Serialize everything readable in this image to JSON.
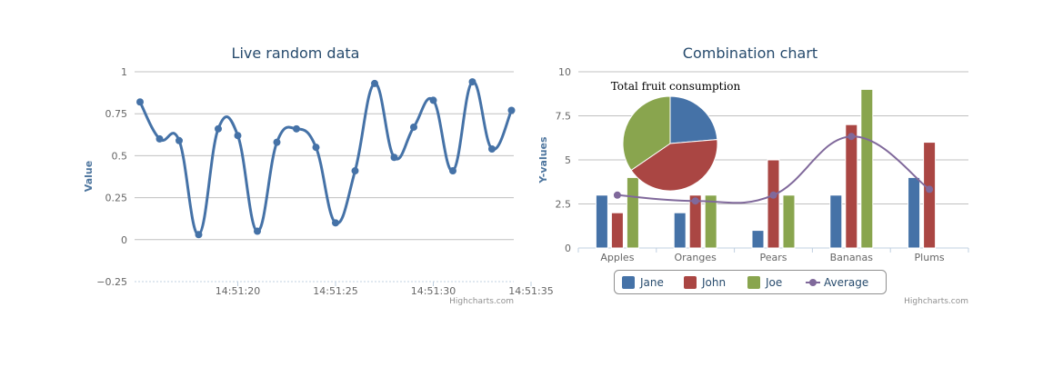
{
  "chart_data": [
    {
      "type": "line",
      "title": "Live random data",
      "xlabel": "",
      "ylabel": "Value",
      "ylim": [
        -0.25,
        1
      ],
      "yticks": [
        "1",
        "0.75",
        "0.5",
        "0.25",
        "0",
        "−0.25"
      ],
      "xticks": [
        "14:51:20",
        "14:51:25",
        "14:51:30",
        "14:51:35"
      ],
      "x": [
        "14:51:15",
        "14:51:16",
        "14:51:17",
        "14:51:18",
        "14:51:19",
        "14:51:20",
        "14:51:21",
        "14:51:22",
        "14:51:23",
        "14:51:24",
        "14:51:25",
        "14:51:26",
        "14:51:27",
        "14:51:28",
        "14:51:29",
        "14:51:30",
        "14:51:31",
        "14:51:32",
        "14:51:33",
        "14:51:34"
      ],
      "series": [
        {
          "values": [
            0.82,
            0.6,
            0.59,
            0.03,
            0.66,
            0.62,
            0.05,
            0.58,
            0.66,
            0.55,
            0.1,
            0.41,
            0.93,
            0.49,
            0.67,
            0.83,
            0.41,
            0.94,
            0.54,
            0.77
          ],
          "color": "#4572a7"
        }
      ],
      "grid": true,
      "credits": "Highcharts.com"
    },
    {
      "type": "bar",
      "title": "Combination chart",
      "xlabel": "",
      "ylabel": "Y-values",
      "ylim": [
        0,
        10
      ],
      "yticks": [
        "0",
        "2.5",
        "5",
        "7.5",
        "10"
      ],
      "categories": [
        "Apples",
        "Oranges",
        "Pears",
        "Bananas",
        "Plums"
      ],
      "series": [
        {
          "name": "Jane",
          "values": [
            3,
            2,
            1,
            3,
            4
          ],
          "color": "#4572a7"
        },
        {
          "name": "John",
          "values": [
            2,
            3,
            5,
            7,
            6
          ],
          "color": "#aa4643"
        },
        {
          "name": "Joe",
          "values": [
            4,
            3,
            3,
            9,
            0
          ],
          "color": "#89a54e"
        },
        {
          "name": "Average",
          "type": "spline",
          "values": [
            3,
            2.67,
            3,
            6.33,
            3.33
          ],
          "color": "#80699b"
        }
      ],
      "pie": {
        "title": "Total fruit consumption",
        "slices": [
          {
            "name": "Jane",
            "value": 13,
            "color": "#4572a7"
          },
          {
            "name": "John",
            "value": 23,
            "color": "#aa4643"
          },
          {
            "name": "Joe",
            "value": 19,
            "color": "#89a54e"
          }
        ]
      },
      "legend": "bottom-center",
      "grid": true,
      "credits": "Highcharts.com"
    }
  ]
}
